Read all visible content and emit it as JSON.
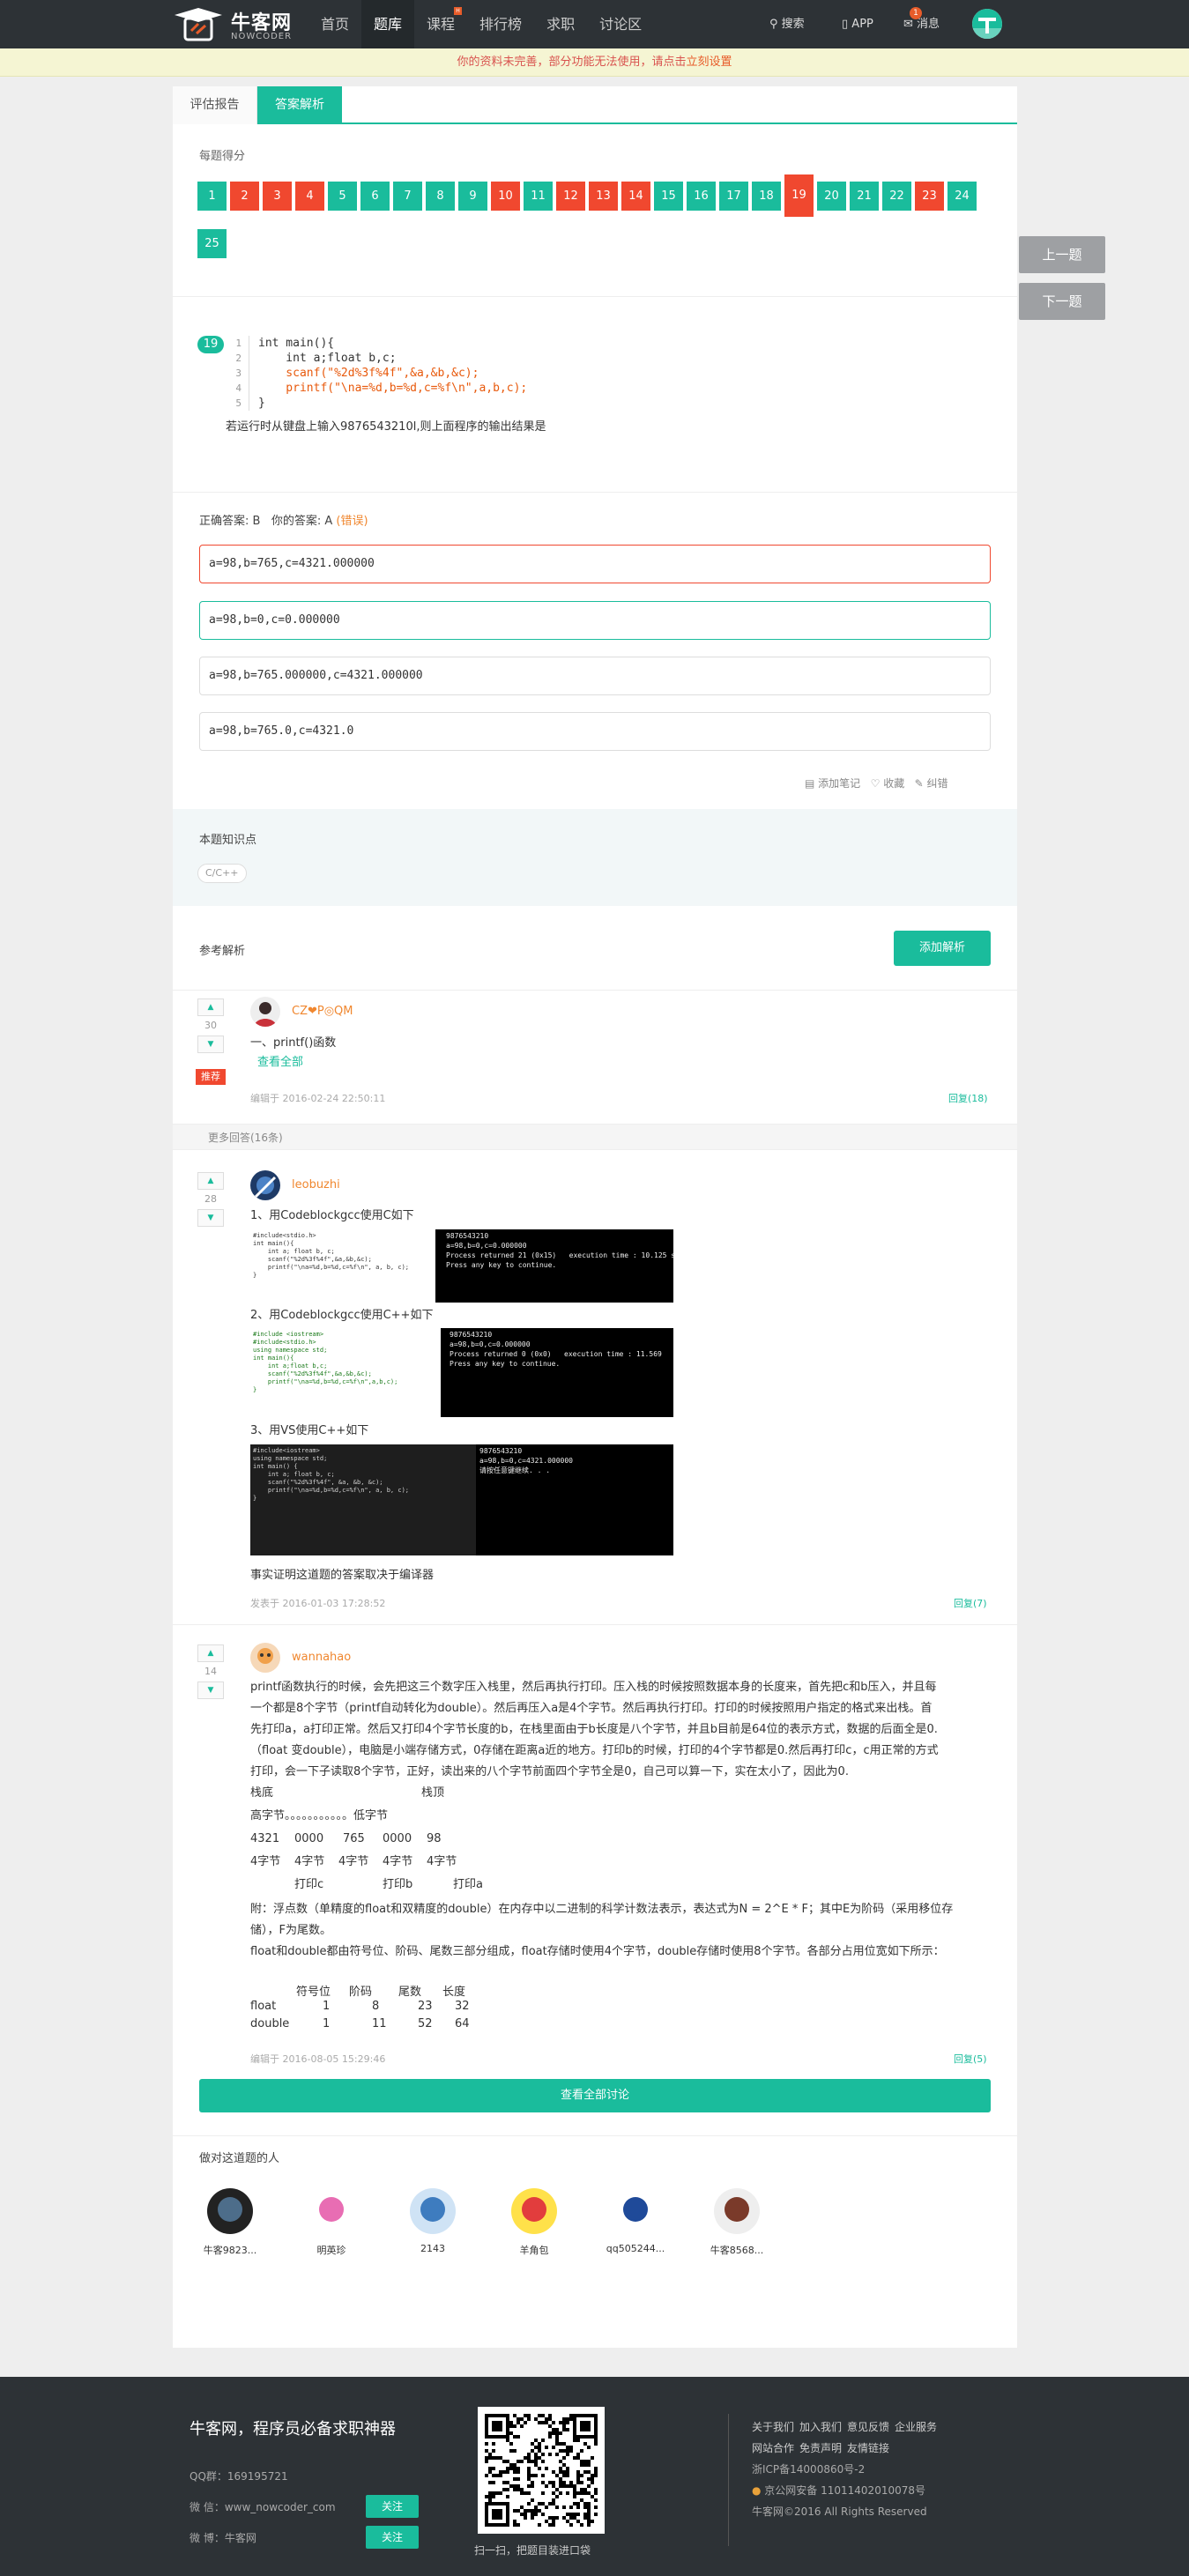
{
  "header": {
    "logo_text": "牛客网",
    "logo_sub": "NOWCODER",
    "nav": [
      "首页",
      "题库",
      "课程",
      "排行榜",
      "求职",
      "讨论区"
    ],
    "nav_active": "题库",
    "search": "搜索",
    "app": "APP",
    "messages": "消息",
    "msg_badge": "1"
  },
  "notice": {
    "text": "你的资料未完善，部分功能无法使用，请点击",
    "link": "立刻设置"
  },
  "tabs": {
    "report": "评估报告",
    "analysis": "答案解析"
  },
  "score": {
    "label": "每题得分",
    "numbers": [
      "1",
      "2",
      "3",
      "4",
      "5",
      "6",
      "7",
      "8",
      "9",
      "10",
      "11",
      "12",
      "13",
      "14",
      "15",
      "16",
      "17",
      "18",
      "19",
      "20",
      "21",
      "22",
      "23",
      "24",
      "25"
    ],
    "status": [
      "ok",
      "bad",
      "bad",
      "bad",
      "ok",
      "ok",
      "ok",
      "ok",
      "ok",
      "bad",
      "ok",
      "bad",
      "bad",
      "bad",
      "ok",
      "ok",
      "ok",
      "ok",
      "cur",
      "ok",
      "ok",
      "ok",
      "bad",
      "ok",
      "ok"
    ]
  },
  "side": {
    "prev": "上一题",
    "next": "下一题"
  },
  "question": {
    "number": "19",
    "line_numbers": [
      "1",
      "2",
      "3",
      "4",
      "5"
    ],
    "code": [
      "int main(){",
      "    int a;float b,c;",
      "    scanf(\"%2d%3f%4f\",&a,&b,&c);",
      "    printf(\"\\na=%d,b=%d,c=%f\\n\",a,b,c);",
      "}"
    ],
    "text": "若运行时从键盘上输入9876543210l,则上面程序的输出结果是"
  },
  "answer": {
    "correct_label": "正确答案: B",
    "yours_label": "你的答案: A",
    "wrong": "(错误)"
  },
  "options": [
    "a=98,b=765,c=4321.000000",
    "a=98,b=0,c=0.000000",
    "a=98,b=765.000000,c=4321.000000",
    "a=98,b=765.0,c=4321.0"
  ],
  "actions": {
    "note": "添加笔记",
    "fav": "收藏",
    "fix": "纠错"
  },
  "knowledge": {
    "label": "本题知识点",
    "tag": "C/C++"
  },
  "analysis": {
    "label": "参考解析",
    "add_btn": "添加解析"
  },
  "post1": {
    "votes": "30",
    "user": "CZ❤P◎QM",
    "recommend": "推荐",
    "line": "一、printf()函数",
    "view_all": "查看全部",
    "meta": "编辑于 2016-02-24 22:50:11",
    "reply": "回复(18)"
  },
  "more": "更多回答(16条)",
  "post2": {
    "votes": "28",
    "user": "leobuzhi",
    "s1": "1、用Codeblockgcc使用C如下",
    "s2": "2、用Codeblockgcc使用C++如下",
    "s3": "3、用VS使用C++如下",
    "conclusion": "事实证明这道题的答案取决于编译器",
    "meta": "发表于 2016-01-03 17:28:52",
    "reply": "回复(7)",
    "shot1_con": [
      "9876543210",
      "a=98,b=0,c=0.000000",
      "",
      "Process returned 21 (0x15)   execution time : 10.125 s",
      "Press any key to continue."
    ],
    "shot2_con": [
      "9876543210",
      "a=98,b=0,c=0.000000",
      "",
      "Process returned 0 (0x0)   execution time : 11.569",
      "Press any key to continue."
    ],
    "shot3_con": [
      "9876543210",
      "",
      "a=98,b=0,c=4321.000000",
      "请按任意键继续. . ."
    ],
    "shot1_ide": [
      "#include<stdio.h>",
      "int main(){",
      "    int a; float b, c;",
      "    scanf(\"%2d%3f%4f\",&a,&b,&c);",
      "    printf(\"\\na=%d,b=%d,c=%f\\n\", a, b, c);",
      "}"
    ],
    "shot2_ide": [
      "#include <iostream>",
      "#include<stdio.h>",
      "using namespace std;",
      "",
      "int main(){",
      "    int a;float b,c;",
      "    scanf(\"%2d%3f%4f\",&a,&b,&c);",
      "    printf(\"\\na=%d,b=%d,c=%f\\n\",a,b,c);",
      "}"
    ],
    "shot3_ide": [
      "#include<iostream>",
      "using namespace std;",
      "int main() {",
      "    int a; float b, c;",
      "    scanf(\"%2d%3f%4f\", &a, &b, &c);",
      "    printf(\"\\na=%d,b=%d,c=%f\\n\", a, b, c);",
      "}"
    ]
  },
  "post3": {
    "votes": "14",
    "user": "wannahao",
    "para1": [
      "printf函数执行的时候，会先把这三个数字压入栈里，然后再执行打印。压入栈的时候按照数据本身的长度来，首先把c和b压入，并且每",
      "一个都是8个字节（printf自动转化为double）。然后再压入a是4个字节。然后再执行打印。打印的时候按照用户指定的格式来出栈。首",
      "先打印a，a打印正常。然后又打印4个字节长度的b，在栈里面由于b长度是八个字节，并且b目前是64位的表示方式，数据的后面全是0.",
      "（float 变double），电脑是小端存储方式，0存储在距离a近的地方。打印b的时候，打印的4个字节都是0.然后再打印c，c用正常的方式",
      "打印，会一下子读取8个字节，正好，读出来的八个字节前面四个字节全是0，自己可以算一下，实在太小了，因此为0."
    ],
    "stack_l": "栈底",
    "stack_r": "栈顶",
    "hi": "高字节。。。。。。。。。。。低字节",
    "row1": [
      "4321",
      "0000",
      "765",
      "0000",
      "98"
    ],
    "row2": [
      "4字节",
      "4字节",
      "4字节",
      "4字节",
      "4字节"
    ],
    "row3": [
      "打印c",
      "打印b",
      "打印a"
    ],
    "para2": [
      "附：浮点数（单精度的float和双精度的double）在内存中以二进制的科学计数法表示，表达式为N = 2^E * F；其中E为阶码（采用移位存",
      "储），F为尾数。",
      "float和double都由符号位、阶码、尾数三部分组成，float存储时使用4个字节，double存储时使用8个字节。各部分占用位宽如下所示："
    ],
    "table_head": [
      "符号位",
      "阶码",
      "尾数",
      "长度"
    ],
    "table_rows": [
      [
        "float",
        "1",
        "8",
        "23",
        "32"
      ],
      [
        "double",
        "1",
        "11",
        "52",
        "64"
      ]
    ],
    "meta": "编辑于 2016-08-05 15:29:46",
    "reply": "回复(5)"
  },
  "view_all_btn": "查看全部讨论",
  "people": {
    "label": "做对这道题的人",
    "names": [
      "牛客9823...",
      "明英珍",
      "2143",
      "羊角包",
      "qq505244...",
      "牛客8568..."
    ]
  },
  "footer": {
    "slogan": "牛客网，程序员必备求职神器",
    "qq": "QQ群：169195721",
    "wechat": "微 信：www_nowcoder_com",
    "weibo": "微 博：牛客网",
    "follow": "关注",
    "qr_text": "扫一扫，把题目装进口袋",
    "links1": [
      "关于我们",
      "加入我们",
      "意见反馈",
      "企业服务"
    ],
    "links2": [
      "网站合作",
      "免责声明",
      "友情链接"
    ],
    "icp": "浙ICP备14000860号-2",
    "police": "京公网安备 11011402010078号",
    "copyright": "牛客网©2016 All Rights Reserved"
  }
}
